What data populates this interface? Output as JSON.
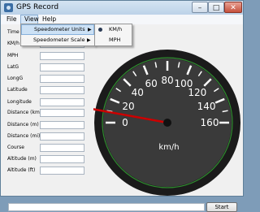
{
  "window": {
    "title": "GPS Record"
  },
  "titlebar_buttons": {
    "minimize": "–",
    "maximize": "□",
    "close": "✕"
  },
  "menubar": {
    "file": "File",
    "view": "View",
    "help": "Help"
  },
  "view_menu": {
    "items": [
      {
        "label": "Speedometer Units"
      },
      {
        "label": "Speedometer Scale"
      }
    ],
    "arrow": "▶"
  },
  "units_submenu": {
    "items": [
      {
        "label": "KM/h",
        "checked": true
      },
      {
        "label": "MPH",
        "checked": false
      }
    ]
  },
  "fields": [
    {
      "label": "Time",
      "value": ""
    },
    {
      "label": "KM/h",
      "value": ""
    },
    {
      "label": "MPH",
      "value": ""
    },
    {
      "label": "LatG",
      "value": ""
    },
    {
      "label": "LongG",
      "value": ""
    },
    {
      "label": "Latitude",
      "value": ""
    },
    {
      "label": "Longitude",
      "value": ""
    },
    {
      "label": "Distance (km)",
      "value": ""
    },
    {
      "label": "Distance (m)",
      "value": ""
    },
    {
      "label": "Distance (mi)",
      "value": ""
    },
    {
      "label": "Course",
      "value": ""
    },
    {
      "label": "Altitude (m)",
      "value": ""
    },
    {
      "label": "Altitude (ft)",
      "value": ""
    }
  ],
  "speedometer": {
    "unit_label": "km/h",
    "tick_labels": [
      "0",
      "20",
      "40",
      "60",
      "80",
      "100",
      "120",
      "140",
      "160"
    ],
    "min": 0,
    "max": 160,
    "needle_value": 0,
    "colors": {
      "face": "#3a3a3a",
      "bezel": "#1b1b1b",
      "ring": "#2e8b2e",
      "ticks": "#ffffff",
      "needle": "#cc0000"
    }
  },
  "status_bar": {
    "text": ""
  },
  "start_button": {
    "label": "Start"
  }
}
